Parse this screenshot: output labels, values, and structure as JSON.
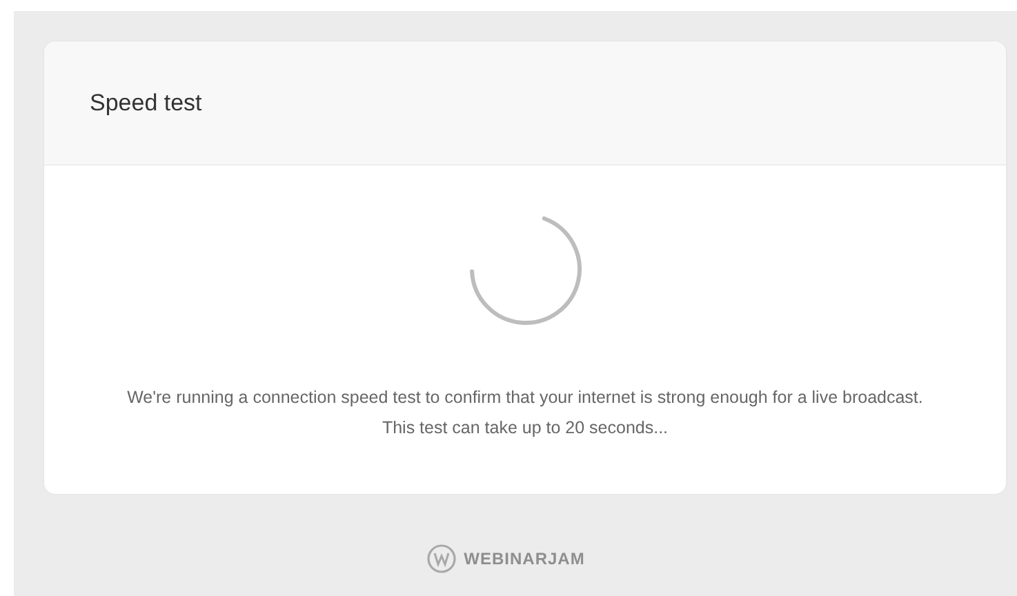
{
  "card": {
    "title": "Speed test",
    "message": "We're running a connection speed test to confirm that your internet is strong enough for a live broadcast. This test can take up to 20 seconds..."
  },
  "footer": {
    "logo_text": "WEBINARJAM"
  }
}
